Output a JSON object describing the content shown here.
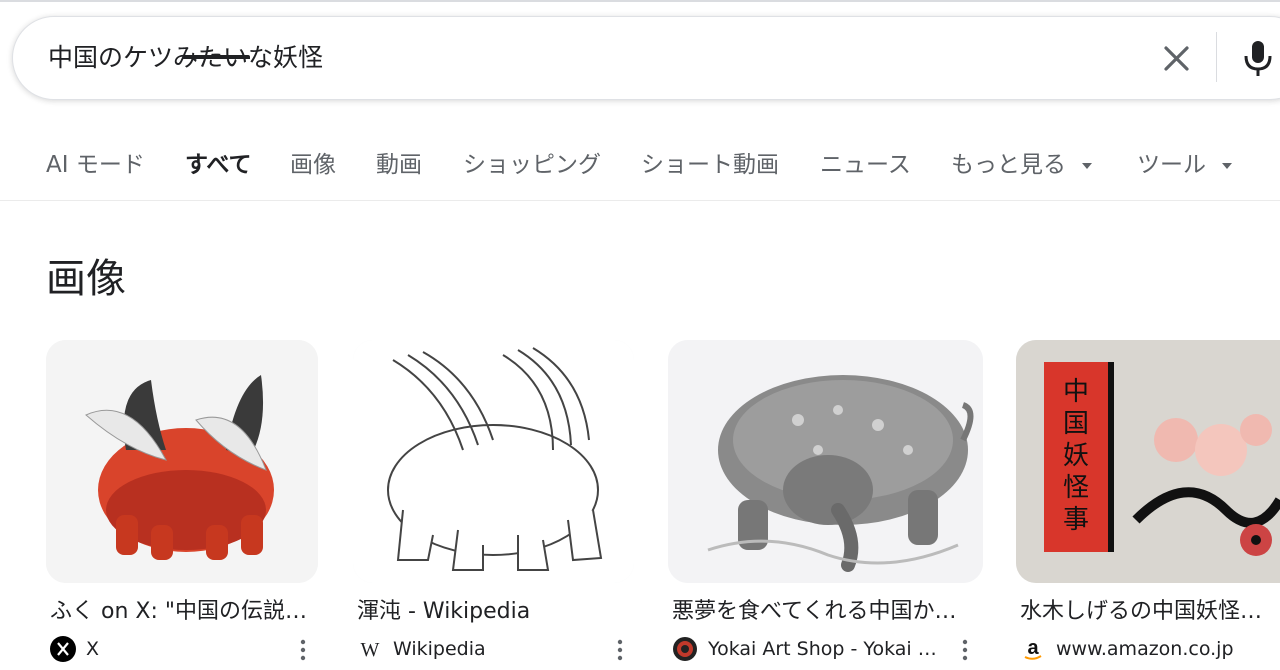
{
  "search": {
    "query": "中国のケツみたいな妖怪"
  },
  "tabs": [
    {
      "label": "AI モード"
    },
    {
      "label": "すべて",
      "active": true
    },
    {
      "label": "画像"
    },
    {
      "label": "動画"
    },
    {
      "label": "ショッピング"
    },
    {
      "label": "ショート動画"
    },
    {
      "label": "ニュース"
    },
    {
      "label": "もっと見る",
      "has_dropdown": true
    },
    {
      "label": "ツール",
      "has_dropdown": true
    }
  ],
  "images_section": {
    "heading": "画像",
    "results": [
      {
        "title": "ふく on X: \"中国の伝説の生き物の\"渾沌\"",
        "source": "X",
        "source_icon": "x-logo-icon",
        "thumb_icon": "red-winged-creature-illustration"
      },
      {
        "title": "渾沌 - Wikipedia",
        "source": "Wikipedia",
        "source_icon": "wikipedia-w-icon",
        "thumb_icon": "line-drawing-winged-creature"
      },
      {
        "title": "悪夢を食べてくれる中国かしら",
        "source": "Yokai Art Shop - Yokai Art",
        "source_icon": "yokai-art-shop-icon",
        "thumb_icon": "baku-tapir-creature-illustration"
      },
      {
        "title": "水木しげるの中国妖怪事典",
        "source": "www.amazon.co.jp",
        "source_icon": "amazon-a-icon",
        "thumb_icon": "book-cover-illustration"
      }
    ]
  },
  "colors": {
    "text_primary": "#202124",
    "text_secondary": "#5f6368",
    "border": "#dfe1e5",
    "mic_blue": "#4285f4",
    "creature_red": "#d9442b"
  }
}
